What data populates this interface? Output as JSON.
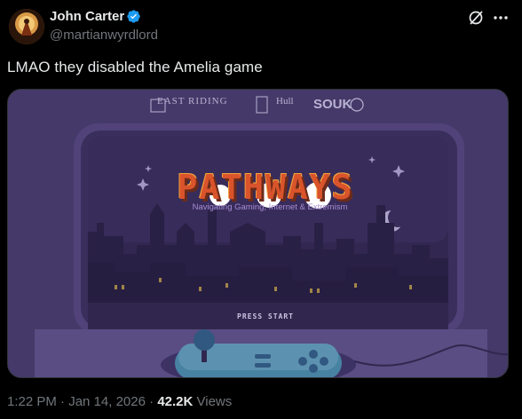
{
  "author": {
    "name": "John Carter",
    "handle": "@martianwyrdlord",
    "verified": true
  },
  "post": {
    "text": "LMAO they disabled the Amelia game"
  },
  "media": {
    "logos": {
      "east_riding": "EAST RIDING",
      "hull": "Hull",
      "souk": "SOUK"
    },
    "game_title": "PATHWAYS",
    "subtitle": "Navigating Gaming, Internet & Extremism",
    "press_start": "PRESS START"
  },
  "meta": {
    "time": "1:22 PM",
    "separator": "·",
    "date": "Jan 14, 2026",
    "views_count": "42.2K",
    "views_label": "Views"
  },
  "colors": {
    "background": "#000000",
    "text": "#e7e9ea",
    "muted": "#71767b",
    "verified_blue": "#1d9bf0"
  }
}
